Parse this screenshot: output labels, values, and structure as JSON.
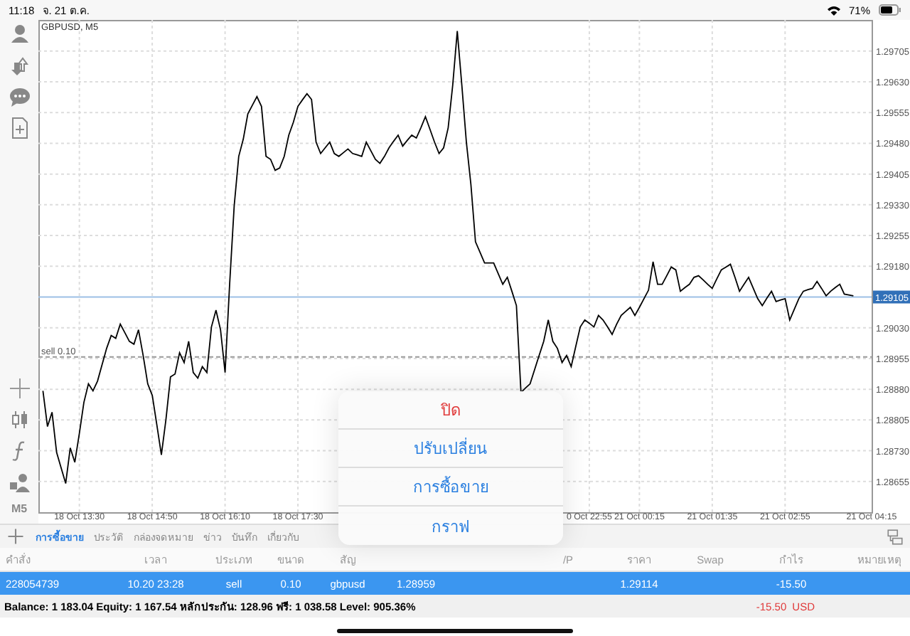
{
  "status_bar": {
    "time": "11:18",
    "date": "จ. 21 ต.ค.",
    "battery": "71%"
  },
  "toolbar": {
    "timeframe": "M5"
  },
  "chart": {
    "chart_data": {
      "type": "line",
      "title": "GBPUSD, M5",
      "categories": [
        null,
        null,
        null,
        null,
        null,
        null,
        null,
        null,
        null,
        "18 Oct 13:30",
        null,
        null,
        null,
        null,
        null,
        null,
        null,
        null,
        null,
        null,
        null,
        null,
        null,
        null,
        null,
        "18 Oct 14:50",
        null,
        null,
        null,
        null,
        null,
        null,
        null,
        null,
        null,
        null,
        null,
        null,
        null,
        null,
        null,
        "18 Oct 16:10",
        null,
        null,
        null,
        null,
        null,
        null,
        null,
        null,
        null,
        null,
        null,
        null,
        null,
        null,
        null,
        "18 Oct 17:30",
        null,
        null,
        null,
        null,
        null,
        null,
        null,
        null,
        null,
        null,
        null,
        null,
        null,
        null,
        null,
        null,
        null,
        null,
        null,
        null,
        null,
        null,
        null,
        null,
        null,
        null,
        null,
        null,
        null,
        null,
        null,
        null,
        null,
        null,
        null,
        null,
        null,
        null,
        null,
        null,
        null,
        null,
        null,
        null,
        null,
        null,
        null,
        null,
        null,
        null,
        null,
        null,
        null,
        null,
        null,
        null,
        null,
        null,
        null,
        null,
        null,
        null,
        null,
        "0 Oct 22:55",
        null,
        null,
        null,
        null,
        null,
        null,
        null,
        null,
        null,
        null,
        "21 Oct 00:15",
        null,
        null,
        null,
        null,
        null,
        null,
        null,
        null,
        null,
        null,
        null,
        null,
        null,
        null,
        null,
        "21 Oct 01:35",
        null,
        null,
        null,
        null,
        null,
        null,
        null,
        null,
        null,
        null,
        null,
        null,
        null,
        null,
        null,
        "21 Oct 02:55",
        null,
        null,
        null,
        null,
        null,
        null,
        null,
        null,
        null,
        null,
        null,
        null,
        null,
        null,
        null,
        null,
        null,
        null,
        "21 Oct 04:15"
      ],
      "series": [
        {
          "color": "#000000",
          "values": [
            null,
            1.28876,
            1.28789,
            1.28824,
            1.28726,
            1.28688,
            1.2865,
            1.28737,
            1.28702,
            1.28772,
            1.28848,
            1.28893,
            1.28876,
            1.289,
            1.2894,
            1.2898,
            1.29011,
            1.29004,
            1.29039,
            1.29018,
            1.28997,
            1.2899,
            1.29025,
            1.28962,
            1.28893,
            1.28865,
            1.28793,
            1.2872,
            1.28806,
            1.2891,
            1.28917,
            1.28969,
            1.28945,
            1.28997,
            1.28921,
            1.28907,
            1.28935,
            1.28921,
            1.29032,
            1.29073,
            1.29025,
            1.28921,
            1.29136,
            1.29327,
            1.29448,
            1.2949,
            1.29552,
            1.29573,
            1.29594,
            1.2957,
            1.29448,
            1.29441,
            1.29414,
            1.2942,
            1.29448,
            1.295,
            1.29531,
            1.2957,
            1.29586,
            1.29601,
            1.29587,
            1.29483,
            1.29455,
            1.29469,
            1.29483,
            1.29455,
            1.29448,
            1.29457,
            1.29466,
            1.29455,
            1.29452,
            1.29448,
            1.29483,
            1.29462,
            1.29441,
            1.29431,
            1.29448,
            1.29469,
            1.29485,
            1.295,
            1.29473,
            1.29487,
            1.295,
            1.29493,
            1.29518,
            1.29545,
            1.29514,
            1.29483,
            1.29455,
            1.29469,
            1.29518,
            1.29622,
            1.29754,
            1.29622,
            1.29483,
            1.29379,
            1.2924,
            1.29214,
            1.29188,
            1.29188,
            1.29188,
            1.29162,
            1.29136,
            1.29153,
            1.29119,
            1.29084,
            1.28872,
            1.28883,
            1.28893,
            1.28928,
            1.28963,
            1.28997,
            1.29049,
            1.28997,
            1.2898,
            1.28945,
            1.28962,
            1.28935,
            1.28984,
            1.29032,
            1.29049,
            1.29041,
            1.29032,
            1.2906,
            1.29049,
            1.29032,
            1.29014,
            1.29039,
            1.2906,
            1.2907,
            1.2908,
            1.2906,
            1.2908,
            1.29101,
            1.29122,
            1.29191,
            1.29136,
            1.29136,
            1.29157,
            1.29178,
            1.29171,
            1.29119,
            1.29128,
            1.29136,
            1.29153,
            1.29157,
            1.29147,
            1.29136,
            1.29126,
            1.29149,
            1.29171,
            1.29178,
            1.29185,
            1.29153,
            1.29119,
            1.29136,
            1.29153,
            1.29127,
            1.29101,
            1.29084,
            1.29102,
            1.29119,
            1.29094,
            1.29098,
            1.29101,
            1.29049,
            1.29075,
            1.29101,
            1.29119,
            1.29123,
            1.29126,
            1.29143,
            1.29126,
            1.29108,
            1.29119,
            1.29128,
            1.29136,
            1.29112,
            1.2911,
            1.29108,
            null,
            null,
            null,
            null
          ]
        }
      ],
      "ylim": [
        1.2858,
        1.29781
      ],
      "grid": true,
      "yticks": [
        {
          "value": 1.29705,
          "label": "1.29705"
        },
        {
          "value": 1.2963,
          "label": "1.29630"
        },
        {
          "value": 1.29555,
          "label": "1.29555"
        },
        {
          "value": 1.2948,
          "label": "1.29480"
        },
        {
          "value": 1.29405,
          "label": "1.29405"
        },
        {
          "value": 1.2933,
          "label": "1.29330"
        },
        {
          "value": 1.29255,
          "label": "1.29255"
        },
        {
          "value": 1.2918,
          "label": "1.29180"
        },
        {
          "value": 1.2903,
          "label": "1.29030"
        },
        {
          "value": 1.28955,
          "label": "1.28955"
        },
        {
          "value": 1.2888,
          "label": "1.28880"
        },
        {
          "value": 1.28805,
          "label": "1.28805"
        },
        {
          "value": 1.2873,
          "label": "1.28730"
        },
        {
          "value": 1.28655,
          "label": "1.28655"
        }
      ],
      "ref_lines": [
        {
          "axis": "y",
          "value": 1.29105,
          "label": "1.29105"
        },
        {
          "axis": "y",
          "value": 1.28959,
          "label": "sell 0.10"
        }
      ]
    }
  },
  "tabs": [
    {
      "label": "การซื้อขาย",
      "selected": true
    },
    {
      "label": "ประวัติ",
      "selected": false
    },
    {
      "label": "กล่องจดหมาย",
      "selected": false
    },
    {
      "label": "ข่าว",
      "selected": false
    },
    {
      "label": "บันทึก",
      "selected": false
    },
    {
      "label": "เกี่ยวกับ",
      "selected": false
    }
  ],
  "table": {
    "columns": [
      "คำสั่ง",
      "เวลา",
      "ประเภท",
      "ขนาด",
      "สัญ",
      null,
      null,
      "/P",
      "ราคา",
      "Swap",
      "กำไร",
      "หมายเหตุ"
    ],
    "rows": [
      {
        "selected": true,
        "cells": [
          "228054739",
          "10.20 23:28",
          "sell",
          "0.10",
          "gbpusd",
          "1.28959",
          null,
          null,
          "1.29114",
          null,
          "-15.50",
          null
        ]
      }
    ]
  },
  "summary": {
    "text": "Balance: 1 183.04 Equity: 1 167.54 หลักประกัน: 128.96 ฟรี: 1 038.58 Level: 905.36%",
    "profit": "-15.50",
    "currency": "USD"
  },
  "action_menu": [
    {
      "label": "ปิด",
      "kind": "destructive"
    },
    {
      "label": "ปรับเปลี่ยน",
      "kind": "default"
    },
    {
      "label": "การซื้อขาย",
      "kind": "default"
    },
    {
      "label": "กราฟ",
      "kind": "default"
    }
  ]
}
